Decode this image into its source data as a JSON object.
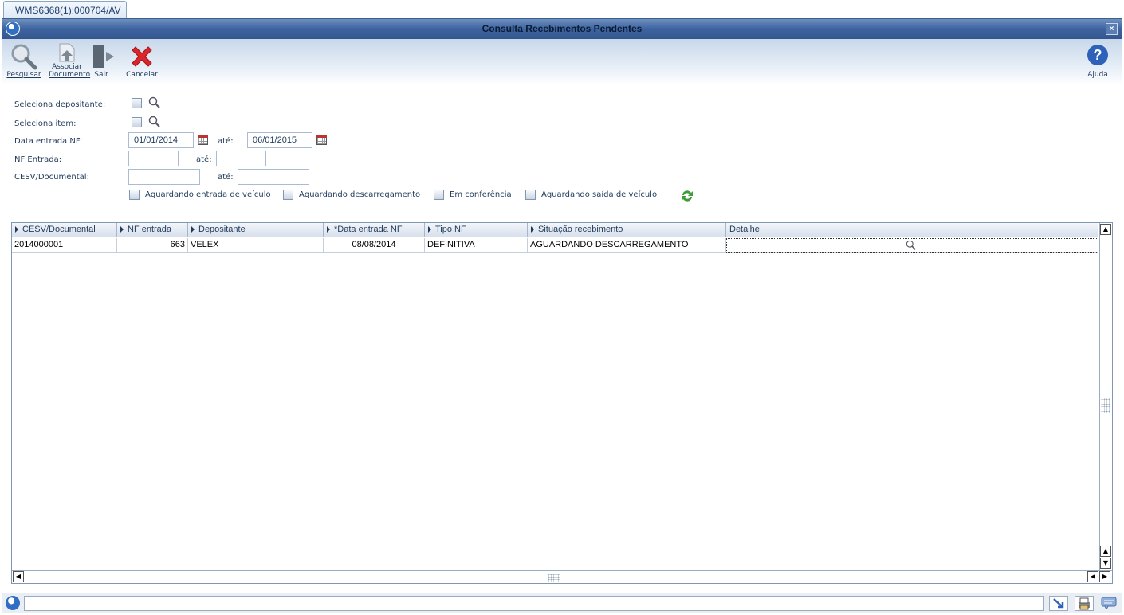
{
  "tab": {
    "label": "WMS6368(1):000704/AV"
  },
  "window": {
    "title": "Consulta Recebimentos Pendentes",
    "close": "×"
  },
  "toolbar": {
    "search": {
      "label": "Pesquisar"
    },
    "associate": {
      "label_line1": "Associar",
      "label_line2": "Documento"
    },
    "exit": {
      "label": "Sair"
    },
    "cancel": {
      "label": "Cancelar"
    },
    "help": {
      "label": "Ajuda"
    }
  },
  "form": {
    "depositor_label": "Seleciona depositante:",
    "item_label": "Seleciona item:",
    "date_label": "Data entrada NF:",
    "date_from": "01/01/2014",
    "date_to": "06/01/2015",
    "until_label": "até:",
    "nf_label": "NF Entrada:",
    "nf_from": "",
    "nf_to": "",
    "cesv_label": "CESV/Documental:",
    "cesv_from": "",
    "cesv_to": "",
    "filters": [
      {
        "label": "Aguardando entrada de veículo"
      },
      {
        "label": "Aguardando descarregamento"
      },
      {
        "label": "Em conferência"
      },
      {
        "label": "Aguardando saída de veículo"
      }
    ]
  },
  "grid": {
    "columns": [
      "CESV/Documental",
      "NF entrada",
      "Depositante",
      "*Data entrada NF",
      "Tipo NF",
      "Situação recebimento",
      "Detalhe"
    ],
    "rows": [
      {
        "cesv": "2014000001",
        "nf": "663",
        "depositante": "VELEX",
        "data": "08/08/2014",
        "tipo": "DEFINITIVA",
        "situacao": "AGUARDANDO DESCARREGAMENTO",
        "detalhe": ""
      }
    ]
  },
  "colors": {
    "titlebar": "#3d63a0",
    "accent": "#2f6ec3",
    "cancel": "#d9252b"
  },
  "icons": [
    "magnifier-icon",
    "associate-document-icon",
    "exit-door-icon",
    "cancel-x-icon",
    "help-icon",
    "calendar-icon",
    "refresh-icon"
  ]
}
